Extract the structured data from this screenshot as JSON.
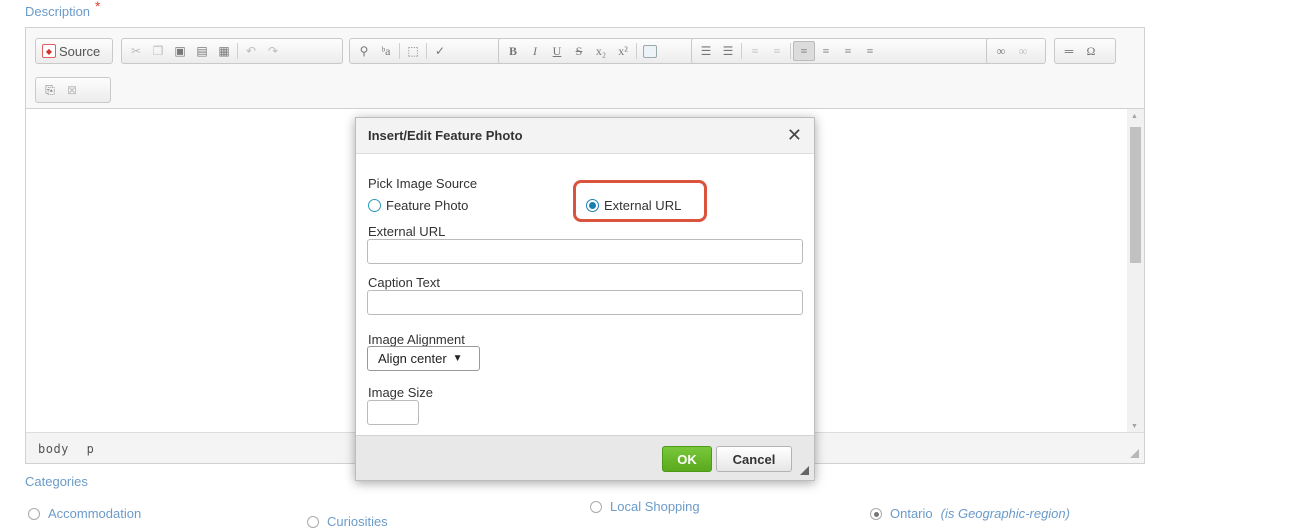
{
  "form": {
    "description_label": "Description",
    "required_marker": "*",
    "categories_label": "Categories"
  },
  "editor": {
    "source_label": "Source",
    "status_path": [
      "body",
      "p"
    ],
    "toolbar_icons": [
      "cut-icon",
      "copy-icon",
      "paste-icon",
      "paste-text-icon",
      "paste-word-icon",
      "undo-icon",
      "redo-icon",
      "find-icon",
      "replace-icon",
      "select-all-icon",
      "spellcheck-icon",
      "bold-icon",
      "italic-icon",
      "underline-icon",
      "strikethrough-icon",
      "subscript-icon",
      "superscript-icon",
      "image-icon",
      "numbered-list-icon",
      "bulleted-list-icon",
      "outdent-icon",
      "indent-icon",
      "align-left-icon",
      "align-center-icon",
      "align-right-icon",
      "justify-icon",
      "link-icon",
      "unlink-icon",
      "horizontal-line-icon",
      "special-char-icon",
      "templates-icon",
      "remove-format-icon"
    ],
    "toolbar_glyphs": {
      "bold": "B",
      "italic": "I",
      "underline": "U",
      "strike": "S",
      "subscript": "x₂",
      "superscript": "x²",
      "special_char": "Ω"
    }
  },
  "dialog": {
    "title": "Insert/Edit Feature Photo",
    "close_glyph": "✕",
    "pick_source_label": "Pick Image Source",
    "option_feature_photo": "Feature Photo",
    "option_external_url": "External URL",
    "selected_source": "External URL",
    "external_url_label": "External URL",
    "external_url_value": "",
    "caption_label": "Caption Text",
    "caption_value": "",
    "alignment_label": "Image Alignment",
    "alignment_value": "Align center",
    "size_label": "Image Size",
    "size_value": "",
    "ok_label": "OK",
    "cancel_label": "Cancel"
  },
  "categories": [
    {
      "label": "Accommodation",
      "note": "",
      "checked": false
    },
    {
      "label": "Curiosities",
      "note": "",
      "checked": false
    },
    {
      "label": "Local Shopping",
      "note": "",
      "checked": false
    },
    {
      "label": "Ontario",
      "note": "(is Geographic-region)",
      "checked": true
    }
  ],
  "colors": {
    "label_blue": "#6b9bc9",
    "required_red": "#e0413a",
    "highlight_red": "#d9533d",
    "ok_green": "#5aa91e",
    "radio_blue": "#1a7fb0"
  }
}
